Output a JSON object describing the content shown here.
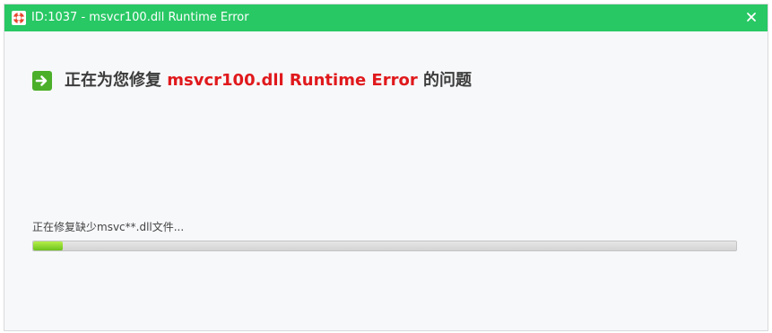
{
  "window": {
    "title": "ID:1037 - msvcr100.dll Runtime Error",
    "icons": {
      "app": "lifebuoy-icon",
      "close": "close-icon"
    },
    "colors": {
      "titlebar": "#28c864",
      "accent_red": "#e0191c",
      "progress": "#7ccf22"
    }
  },
  "main": {
    "heading": {
      "icon": "arrow-right-icon",
      "prefix": "正在为您修复",
      "error_name": "msvcr100.dll Runtime Error",
      "suffix": "的问题"
    },
    "status": {
      "text": "正在修复缺少msvc**.dll文件...",
      "progress_percent": 4.2
    }
  }
}
